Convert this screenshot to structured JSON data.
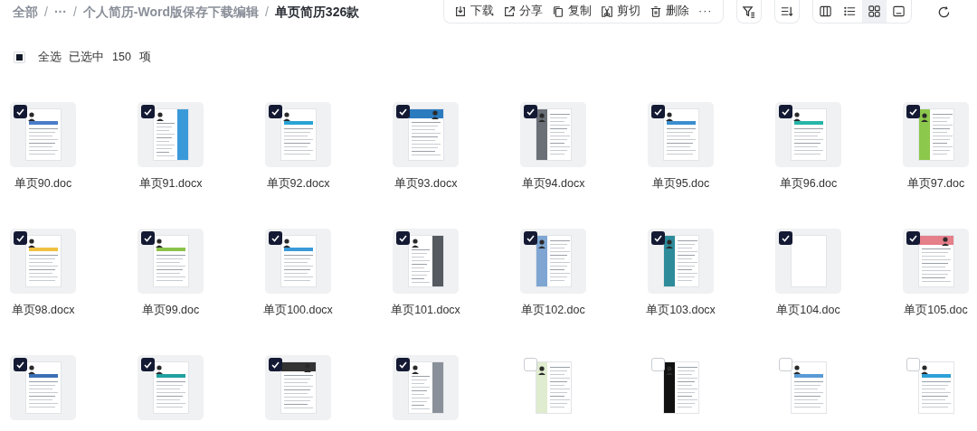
{
  "breadcrumb_separator": "/",
  "breadcrumb": [
    {
      "label": "全部",
      "current": false
    },
    {
      "label": "···",
      "current": false
    },
    {
      "label": "个人简历-Word版保存下载编辑",
      "current": false
    },
    {
      "label": "单页简历326款",
      "current": true
    }
  ],
  "toolbar": {
    "actions": [
      {
        "label": "下载",
        "kind": "download"
      },
      {
        "label": "分享",
        "kind": "share"
      },
      {
        "label": "复制",
        "kind": "copy"
      },
      {
        "label": "剪切",
        "kind": "cut"
      },
      {
        "label": "删除",
        "kind": "delete"
      },
      {
        "label": "···",
        "kind": "more"
      }
    ],
    "views": [
      {
        "kind": "columns",
        "selected": false
      },
      {
        "kind": "list",
        "selected": false
      },
      {
        "kind": "grid",
        "selected": true
      },
      {
        "kind": "preview",
        "selected": false
      }
    ]
  },
  "selection": {
    "select_all_label": "全选",
    "summary": "已选中",
    "count": "150",
    "unit": "项",
    "partial": true
  },
  "files": [
    {
      "name": "单页90.doc",
      "selected": true,
      "kind": "plain",
      "color": "#4a7cc9"
    },
    {
      "name": "单页91.docx",
      "selected": true,
      "kind": "column-right",
      "color": "#3a9ad9"
    },
    {
      "name": "单页92.docx",
      "selected": true,
      "kind": "plain",
      "color": "#29a3d6"
    },
    {
      "name": "单页93.docx",
      "selected": true,
      "kind": "header",
      "color": "#2b7bbf"
    },
    {
      "name": "单页94.docx",
      "selected": true,
      "kind": "sidebar",
      "color": "#6b6f76"
    },
    {
      "name": "单页95.doc",
      "selected": true,
      "kind": "plain",
      "color": "#3a8fd0"
    },
    {
      "name": "单页96.doc",
      "selected": true,
      "kind": "plain",
      "color": "#26b5a8"
    },
    {
      "name": "单页97.doc",
      "selected": true,
      "kind": "sidebar",
      "color": "#8cc84b"
    },
    {
      "name": "单页98.docx",
      "selected": true,
      "kind": "plain",
      "color": "#f0c040"
    },
    {
      "name": "单页99.doc",
      "selected": true,
      "kind": "plain",
      "color": "#8bc34a"
    },
    {
      "name": "单页100.docx",
      "selected": true,
      "kind": "plain",
      "color": "#3a9ad9"
    },
    {
      "name": "单页101.docx",
      "selected": true,
      "kind": "column-right",
      "color": "#555a60"
    },
    {
      "name": "单页102.doc",
      "selected": true,
      "kind": "sidebar",
      "color": "#7fa6d3"
    },
    {
      "name": "单页103.docx",
      "selected": true,
      "kind": "sidebar",
      "color": "#2e8b9a"
    },
    {
      "name": "单页104.doc",
      "selected": true,
      "kind": "blank",
      "color": "#ffffff"
    },
    {
      "name": "单页105.doc",
      "selected": true,
      "kind": "header",
      "color": "#e57f8a"
    },
    {
      "selected": true,
      "kind": "plain",
      "color": "#3a6fb5"
    },
    {
      "selected": true,
      "kind": "plain",
      "color": "#20a0a0"
    },
    {
      "selected": true,
      "kind": "header",
      "color": "#333333"
    },
    {
      "selected": true,
      "kind": "column-right",
      "color": "#8a9099"
    },
    {
      "selected": false,
      "kind": "sidebar",
      "color": "#dfeccf"
    },
    {
      "selected": false,
      "kind": "sidebar",
      "color": "#111111"
    },
    {
      "selected": false,
      "kind": "plain",
      "color": "#5a9bd6"
    },
    {
      "selected": false,
      "kind": "plain",
      "color": "#2ba0d8"
    }
  ]
}
